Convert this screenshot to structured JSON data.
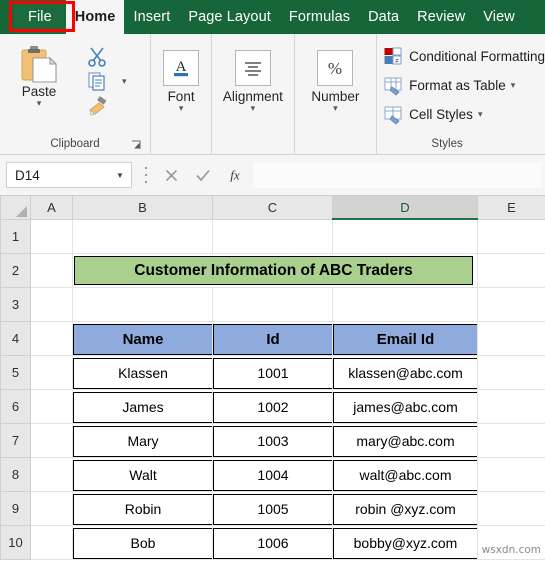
{
  "ribbon": {
    "tabs": [
      {
        "label": "File",
        "id": "file",
        "active": false
      },
      {
        "label": "Home",
        "id": "home",
        "active": true
      },
      {
        "label": "Insert",
        "id": "insert",
        "active": false
      },
      {
        "label": "Page Layout",
        "id": "page-layout",
        "active": false
      },
      {
        "label": "Formulas",
        "id": "formulas",
        "active": false
      },
      {
        "label": "Data",
        "id": "data",
        "active": false
      },
      {
        "label": "Review",
        "id": "review",
        "active": false
      },
      {
        "label": "View",
        "id": "view",
        "active": false
      }
    ],
    "highlight_color": "#ff0000",
    "groups": {
      "clipboard": {
        "label": "Clipboard",
        "paste_label": "Paste",
        "icons": [
          "paste-icon",
          "cut-scissors-icon",
          "copy-icon",
          "format-painter-icon",
          "dialog-launcher-icon"
        ]
      },
      "font": {
        "label": "Font",
        "icon": "font-letter-a-icon"
      },
      "alignment": {
        "label": "Alignment",
        "icon": "align-center-icon"
      },
      "number": {
        "label": "Number",
        "icon": "percent-icon"
      },
      "styles": {
        "label": "Styles",
        "items": [
          {
            "label": "Conditional Formatting",
            "icon": "conditional-formatting-icon",
            "caret": false
          },
          {
            "label": "Format as Table",
            "icon": "format-as-table-icon",
            "caret": true
          },
          {
            "label": "Cell Styles",
            "icon": "cell-styles-icon",
            "caret": true
          }
        ]
      }
    }
  },
  "formula_bar": {
    "name_box_value": "D14",
    "name_box_placeholder": "Name Box",
    "formula_value": "",
    "formula_placeholder": "",
    "cancel_icon": "cancel-x-icon",
    "enter_icon": "enter-check-icon",
    "function_icon": "insert-function-fx-icon"
  },
  "grid": {
    "columns": [
      "A",
      "B",
      "C",
      "D",
      "E"
    ],
    "selected_column": "D",
    "rows": [
      "1",
      "2",
      "3",
      "4",
      "5",
      "6",
      "7",
      "8",
      "9",
      "10"
    ]
  },
  "sheet": {
    "title_banner": {
      "text": "Customer Information of ABC Traders",
      "fill": "#a9d08e",
      "row": "2"
    },
    "table": {
      "header_fill": "#8faadc",
      "headers": [
        "Name",
        "Id",
        "Email Id"
      ],
      "rows": [
        {
          "name": "Klassen",
          "id": "1001",
          "email": "klassen@abc.com"
        },
        {
          "name": "James",
          "id": "1002",
          "email": "james@abc.com"
        },
        {
          "name": "Mary",
          "id": "1003",
          "email": "mary@abc.com"
        },
        {
          "name": "Walt",
          "id": "1004",
          "email": "walt@abc.com"
        },
        {
          "name": "Robin",
          "id": "1005",
          "email": "robin @xyz.com"
        },
        {
          "name": "Bob",
          "id": "1006",
          "email": "bobby@xyz.com"
        }
      ]
    }
  },
  "watermark": {
    "text": "wsxdn.com"
  }
}
